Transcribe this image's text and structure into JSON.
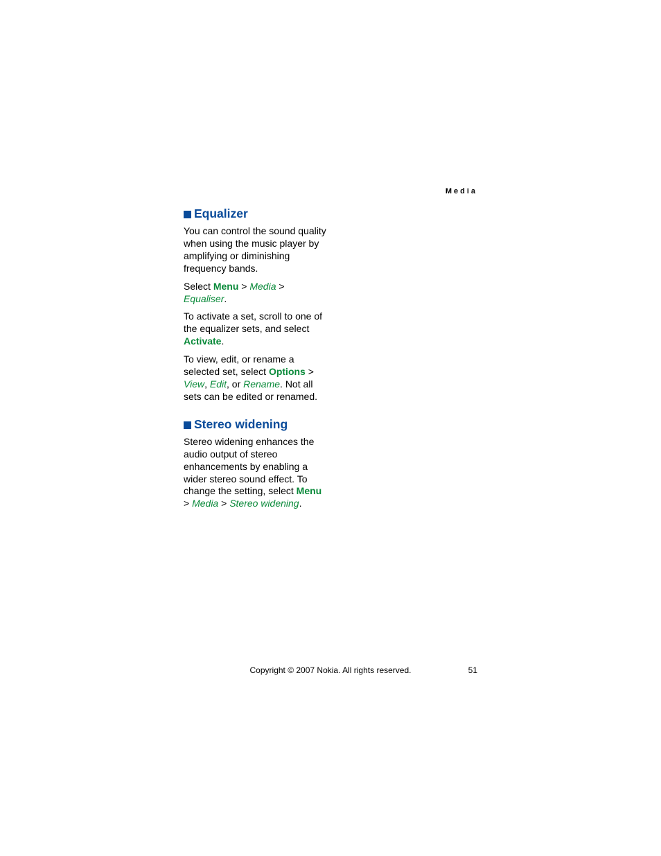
{
  "running_head": "Media",
  "sections": [
    {
      "heading": "Equalizer",
      "p1": "You can control the sound quality when using the music player by amplifying or diminishing frequency bands.",
      "p2a": "Select ",
      "p2_menu1": "Menu",
      "p2_gt1": " > ",
      "p2_nav1": "Media",
      "p2_gt2": " > ",
      "p2_nav2": "Equaliser",
      "p2_end": ".",
      "p3a": "To activate a set, scroll to one of the equalizer sets, and select ",
      "p3_menu": "Activate",
      "p3_end": ".",
      "p4a": "To view, edit, or rename a selected set, select ",
      "p4_menu": "Options",
      "p4_gt": " > ",
      "p4_nav1": "View",
      "p4_comma1": ", ",
      "p4_nav2": "Edit",
      "p4_comma2": ", or ",
      "p4_nav3": "Rename",
      "p4_end": ". Not all sets can be edited or renamed."
    },
    {
      "heading": "Stereo widening",
      "p1a": "Stereo widening enhances the audio output of stereo enhancements by enabling a wider stereo sound effect. To change the setting, select ",
      "p1_menu": "Menu",
      "p1_gt1": " > ",
      "p1_nav1": "Media",
      "p1_gt2": " > ",
      "p1_nav2": "Stereo widening",
      "p1_end": "."
    }
  ],
  "footer": {
    "copyright": "Copyright © 2007 Nokia. All rights reserved.",
    "page": "51"
  }
}
